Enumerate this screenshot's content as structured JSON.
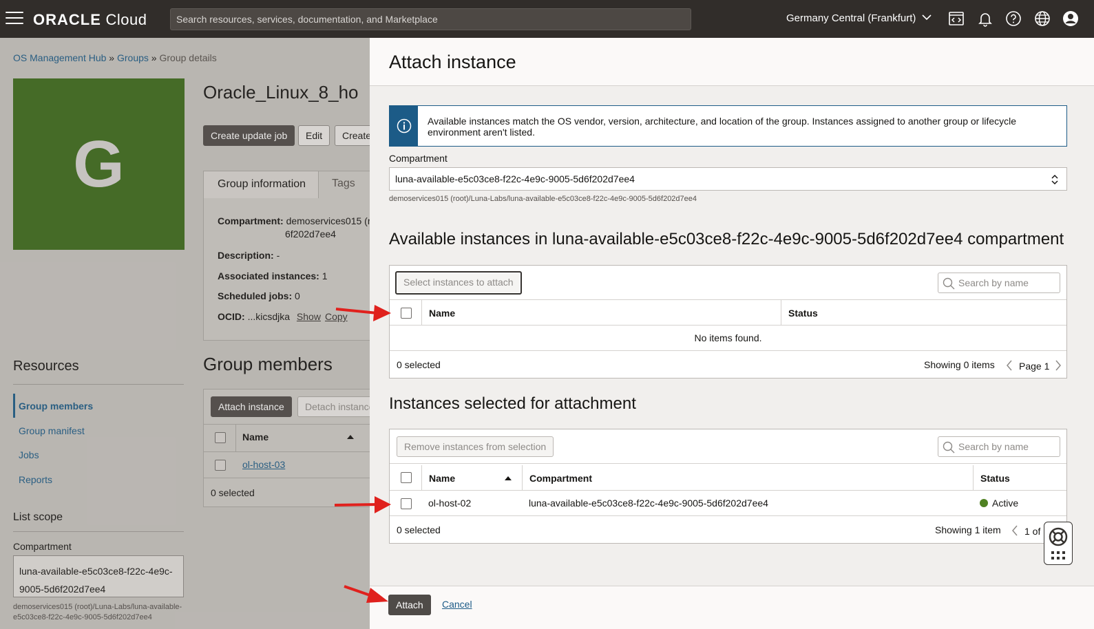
{
  "topbar": {
    "logo_brand": "ORACLE",
    "logo_product": "Cloud",
    "search_placeholder": "Search resources, services, documentation, and Marketplace",
    "region": "Germany Central (Frankfurt)",
    "icons": [
      "code-editor-icon",
      "bell-icon",
      "help-icon",
      "globe-icon",
      "user-icon"
    ]
  },
  "background": {
    "breadcrumb": {
      "items": [
        "OS Management Hub",
        "Groups"
      ],
      "current": "Group details",
      "separator": "»"
    },
    "tile_letter": "G",
    "tile_color": "#3d6a1c",
    "title": "Oracle_Linux_8_ho",
    "buttons": {
      "create_update_job": "Create update job",
      "edit": "Edit",
      "create": "Create"
    },
    "tabs": {
      "group_information": "Group information",
      "tags": "Tags"
    },
    "info": {
      "compartment_label": "Compartment:",
      "compartment_value": "demoservices015 (r",
      "compartment_value_2": "6f202d7ee4",
      "description_label": "Description:",
      "description_value": "-",
      "associated_label": "Associated instances:",
      "associated_value": "1",
      "scheduled_label": "Scheduled jobs:",
      "scheduled_value": "0",
      "ocid_label": "OCID:",
      "ocid_value": "...kicsdjka",
      "show": "Show",
      "copy": "Copy"
    },
    "group_members_title": "Group members",
    "resources": {
      "title": "Resources",
      "items": [
        "Group members",
        "Group manifest",
        "Jobs",
        "Reports"
      ]
    },
    "list_scope": {
      "title": "List scope",
      "compartment_label": "Compartment",
      "compartment_line1": "luna-available-e5c03ce8-f22c-4e9c-",
      "compartment_line2": "9005-5d6f202d7ee4",
      "path": "demoservices015 (root)/Luna-Labs/luna-available-e5c03ce8-f22c-4e9c-9005-5d6f202d7ee4"
    },
    "members_table": {
      "attach_button": "Attach instance",
      "detach_button": "Detach instance",
      "name_header": "Name",
      "rows": [
        "ol-host-03"
      ],
      "selected": "0 selected"
    }
  },
  "drawer": {
    "title": "Attach instance",
    "notice": "Available instances match the OS vendor, version, architecture, and location of the group. Instances assigned to another group or lifecycle environment aren't listed.",
    "compartment_label": "Compartment",
    "compartment_value": "luna-available-e5c03ce8-f22c-4e9c-9005-5d6f202d7ee4",
    "compartment_path": "demoservices015 (root)/Luna-Labs/luna-available-e5c03ce8-f22c-4e9c-9005-5d6f202d7ee4",
    "available": {
      "title": "Available instances in luna-available-e5c03ce8-f22c-4e9c-9005-5d6f202d7ee4 compartment",
      "select_button": "Select instances to attach",
      "search_placeholder": "Search by name",
      "headers": {
        "name": "Name",
        "status": "Status"
      },
      "empty": "No items found.",
      "selected": "0 selected",
      "showing": "Showing 0 items",
      "page": "Page 1"
    },
    "selected_section": {
      "title": "Instances selected for attachment",
      "remove_button": "Remove instances from selection",
      "search_placeholder": "Search by name",
      "headers": {
        "name": "Name",
        "compartment": "Compartment",
        "status": "Status"
      },
      "rows": [
        {
          "name": "ol-host-02",
          "compartment": "luna-available-e5c03ce8-f22c-4e9c-9005-5d6f202d7ee4",
          "status": "Active",
          "status_color": "#508223"
        }
      ],
      "selected": "0 selected",
      "showing": "Showing 1 item",
      "page": "1 of"
    },
    "attach_button": "Attach",
    "cancel_link": "Cancel"
  },
  "colors": {
    "topbar": "#312d2a",
    "link": "#1c5b87",
    "primary_button": "#4f4b48",
    "annotation_arrow": "#e0211d"
  }
}
